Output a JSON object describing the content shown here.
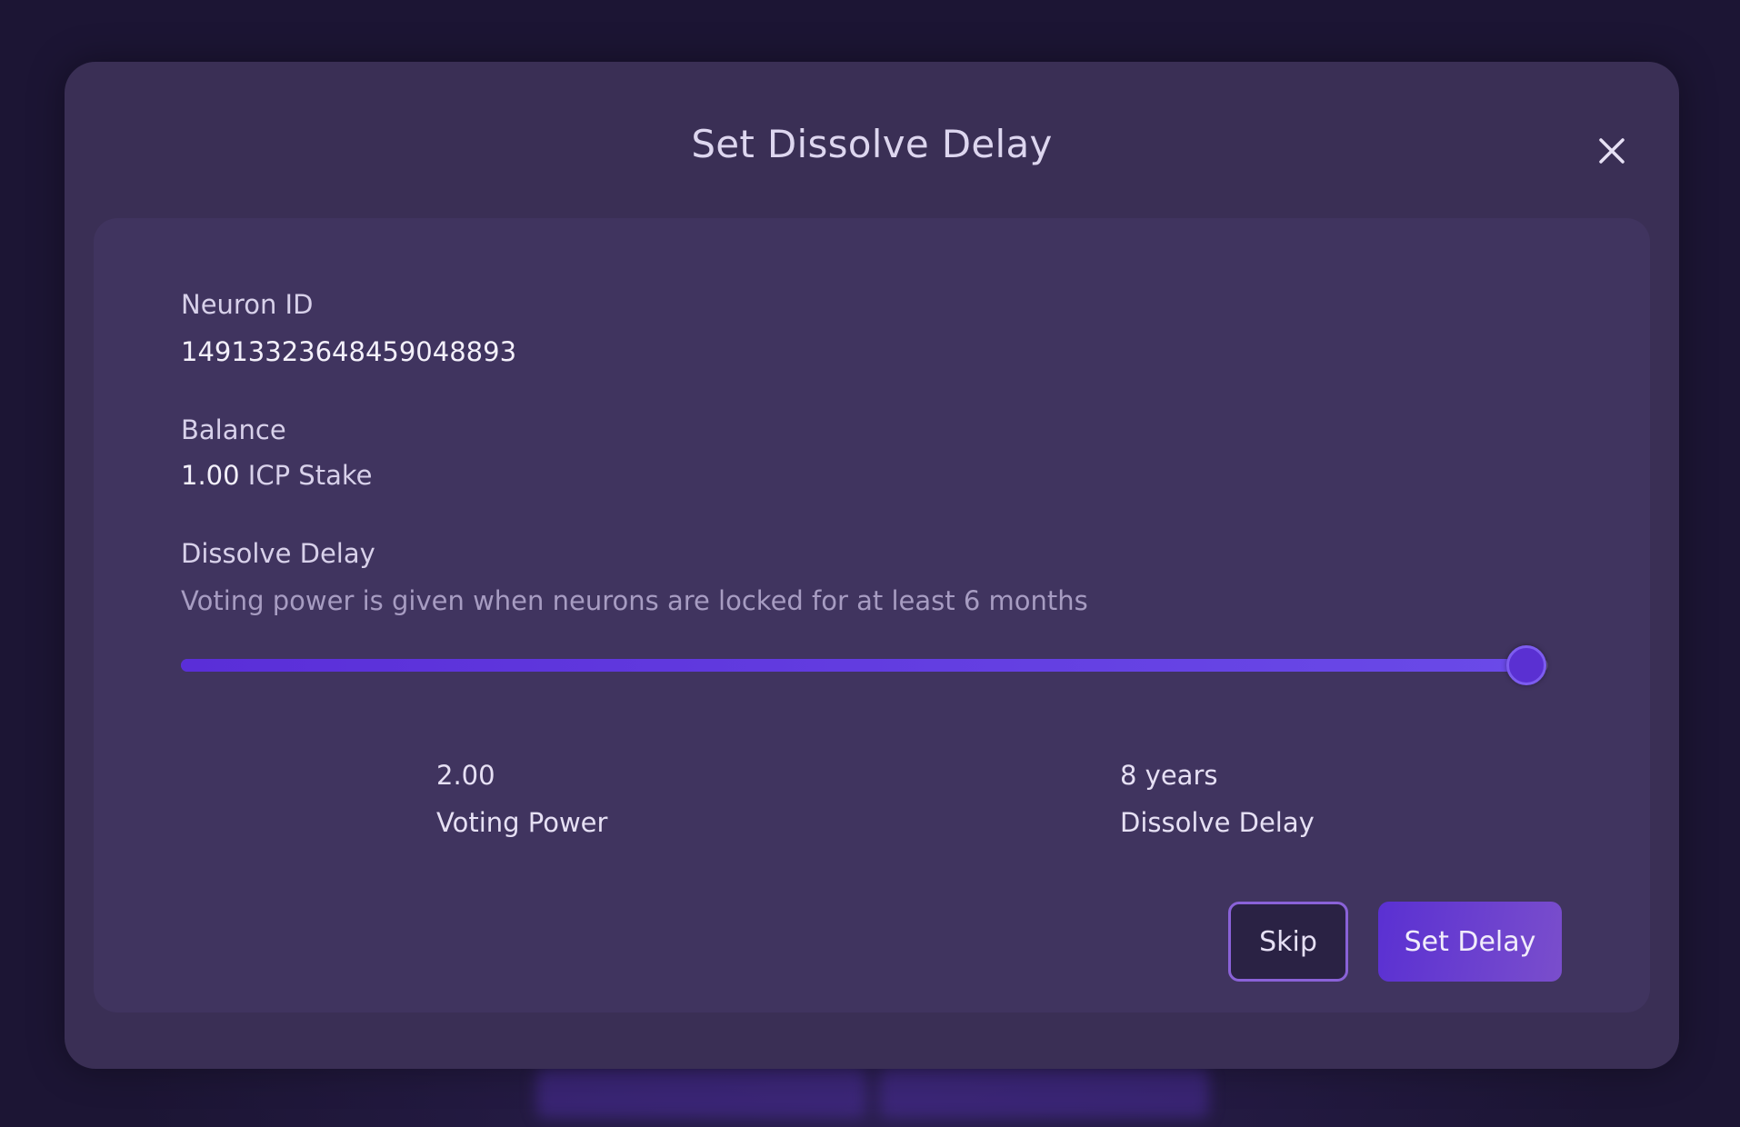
{
  "modal": {
    "title": "Set Dissolve Delay"
  },
  "neuron": {
    "id_label": "Neuron ID",
    "id_value": "14913323648459048893"
  },
  "balance": {
    "label": "Balance",
    "amount": "1.00",
    "unit": "ICP Stake"
  },
  "dissolve": {
    "label": "Dissolve Delay",
    "hint": "Voting power is given when neurons are locked for at least 6 months",
    "slider_fraction": 1.0
  },
  "stats": {
    "voting_power_value": "2.00",
    "voting_power_label": "Voting Power",
    "delay_value": "8 years",
    "delay_label": "Dissolve Delay"
  },
  "buttons": {
    "skip": "Skip",
    "set_delay": "Set Delay"
  },
  "colors": {
    "modal_bg": "#3a2f55",
    "card_bg": "#40345f",
    "accent": "#5a30d2"
  },
  "icons": {
    "close": "close-icon"
  }
}
